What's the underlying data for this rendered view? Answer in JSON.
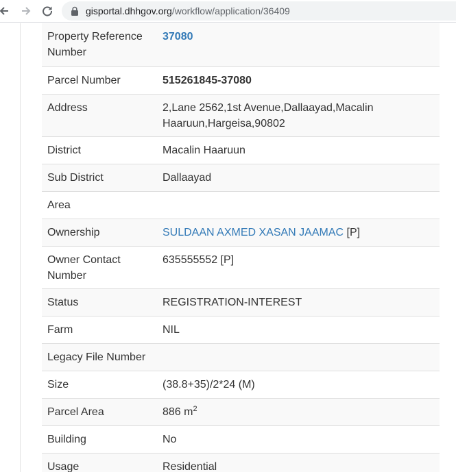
{
  "browser": {
    "url_host": "gisportal.dhhgov.org",
    "url_path": "/workflow/application/36409"
  },
  "rows": [
    {
      "label": "Property Reference Number",
      "value": "37080"
    },
    {
      "label": "Parcel Number",
      "value": "515261845-37080"
    },
    {
      "label": "Address",
      "value": "2,Lane 2562,1st Avenue,Dallaayad,Macalin Haaruun,Hargeisa,90802"
    },
    {
      "label": "District",
      "value": "Macalin Haaruun"
    },
    {
      "label": "Sub District",
      "value": "Dallaayad"
    },
    {
      "label": "Area",
      "value": ""
    },
    {
      "label": "Ownership",
      "value": "SULDAAN AXMED XASAN JAAMAC",
      "suffix": " [P]"
    },
    {
      "label": "Owner Contact Number",
      "value": "635555552 [P]"
    },
    {
      "label": "Status",
      "value": "REGISTRATION-INTEREST"
    },
    {
      "label": "Farm",
      "value": "NIL"
    },
    {
      "label": "Legacy File Number",
      "value": ""
    },
    {
      "label": "Size",
      "value": "(38.8+35)/2*24 (M)"
    },
    {
      "label": "Parcel Area",
      "value": "886 m",
      "sup": "2"
    },
    {
      "label": "Building",
      "value": "No"
    },
    {
      "label": "Usage",
      "value": "Residential"
    }
  ]
}
